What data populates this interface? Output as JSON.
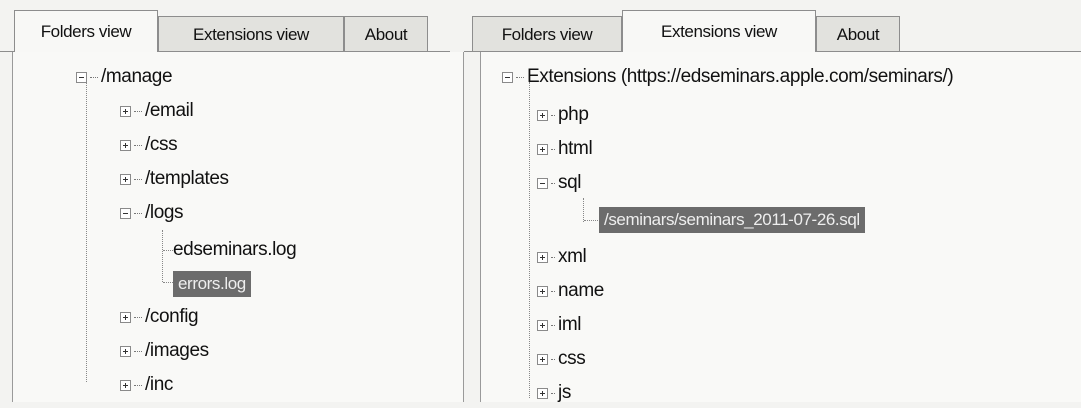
{
  "left_panel": {
    "tabs": [
      {
        "label": "Folders view",
        "active": true
      },
      {
        "label": "Extensions view",
        "active": false
      },
      {
        "label": "About",
        "active": false
      }
    ],
    "root": "/manage",
    "items": [
      {
        "label": "/email",
        "expander": "plus"
      },
      {
        "label": "/css",
        "expander": "plus"
      },
      {
        "label": "/templates",
        "expander": "plus"
      },
      {
        "label": "/logs",
        "expander": "minus",
        "children": [
          {
            "label": "edseminars.log",
            "selected": false
          },
          {
            "label": "errors.log",
            "selected": true
          }
        ]
      },
      {
        "label": "/config",
        "expander": "plus"
      },
      {
        "label": "/images",
        "expander": "plus"
      },
      {
        "label": "/inc",
        "expander": "plus"
      }
    ]
  },
  "right_panel": {
    "tabs": [
      {
        "label": "Folders view",
        "active": false
      },
      {
        "label": "Extensions view",
        "active": true
      },
      {
        "label": "About",
        "active": false
      }
    ],
    "root": "Extensions (https://edseminars.apple.com/seminars/)",
    "items": [
      {
        "label": "php",
        "expander": "plus"
      },
      {
        "label": "html",
        "expander": "plus"
      },
      {
        "label": "sql",
        "expander": "minus",
        "children": [
          {
            "label": "/seminars/seminars_2011-07-26.sql",
            "selected": true
          }
        ]
      },
      {
        "label": "xml",
        "expander": "plus"
      },
      {
        "label": "name",
        "expander": "plus"
      },
      {
        "label": "iml",
        "expander": "plus"
      },
      {
        "label": "css",
        "expander": "plus"
      },
      {
        "label": "js",
        "expander": "plus"
      }
    ]
  }
}
